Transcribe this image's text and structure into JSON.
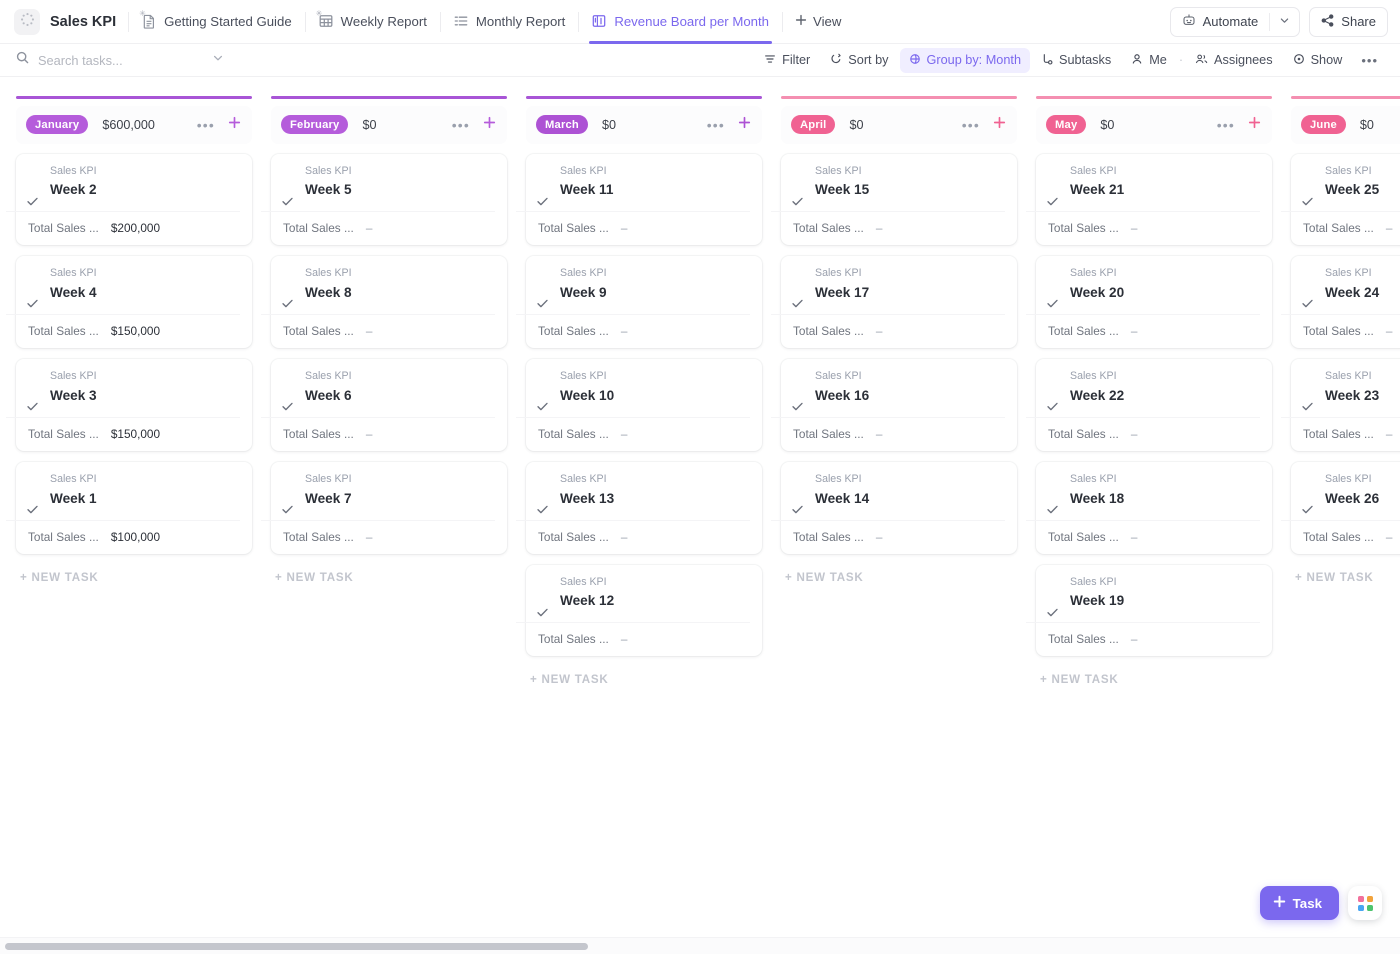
{
  "topbar": {
    "logo_icon": "dotted-circle-icon",
    "space_title": "Sales KPI",
    "tabs": [
      {
        "label": "Getting Started Guide",
        "icon": "doc-icon",
        "active": false
      },
      {
        "label": "Weekly Report",
        "icon": "table-icon",
        "active": false
      },
      {
        "label": "Monthly Report",
        "icon": "list-icon",
        "active": false
      },
      {
        "label": "Revenue Board per Month",
        "icon": "board-icon",
        "active": true
      }
    ],
    "add_view_label": "View",
    "add_view_icon": "plus-icon",
    "automate_label": "Automate",
    "automate_icon": "robot-icon",
    "automate_caret_icon": "chevron-down-icon",
    "share_label": "Share",
    "share_icon": "share-icon"
  },
  "toolbar": {
    "search_icon": "search-icon",
    "search_placeholder": "Search tasks...",
    "search_value": "",
    "search_caret_icon": "chevron-down-icon",
    "items": [
      {
        "label": "Filter",
        "icon": "filter-icon",
        "active": false
      },
      {
        "label": "Sort by",
        "icon": "sort-icon",
        "active": false
      },
      {
        "label": "Group by: Month",
        "icon": "group-icon",
        "active": true
      },
      {
        "label": "Subtasks",
        "icon": "subtask-icon",
        "active": false
      },
      {
        "label": "Me",
        "icon": "person-icon",
        "active": false
      },
      {
        "label": "Assignees",
        "icon": "people-icon",
        "active": false
      },
      {
        "label": "Show",
        "icon": "eye-icon",
        "active": false
      }
    ],
    "separator": "·",
    "more_icon": "ellipsis-icon"
  },
  "board": {
    "new_task_label": "+ NEW TASK",
    "card_list_label": "Sales KPI",
    "field_label": "Total Sales ...",
    "empty_value": "–",
    "check_icon": "check-icon",
    "more_icon": "ellipsis-icon",
    "add_icon": "plus-icon",
    "columns": [
      {
        "month": "January",
        "sum": "$600,000",
        "color": "#b55cdb",
        "top_color": "#a855d6",
        "cards": [
          {
            "title": "Week 2",
            "value": "$200,000"
          },
          {
            "title": "Week 4",
            "value": "$150,000"
          },
          {
            "title": "Week 3",
            "value": "$150,000"
          },
          {
            "title": "Week 1",
            "value": "$100,000"
          }
        ]
      },
      {
        "month": "February",
        "sum": "$0",
        "color": "#b55cdb",
        "top_color": "#a855d6",
        "cards": [
          {
            "title": "Week 5",
            "value": "–"
          },
          {
            "title": "Week 8",
            "value": "–"
          },
          {
            "title": "Week 6",
            "value": "–"
          },
          {
            "title": "Week 7",
            "value": "–"
          }
        ]
      },
      {
        "month": "March",
        "sum": "$0",
        "color": "#ad52d4",
        "top_color": "#a855d6",
        "cards": [
          {
            "title": "Week 11",
            "value": "–"
          },
          {
            "title": "Week 9",
            "value": "–"
          },
          {
            "title": "Week 10",
            "value": "–"
          },
          {
            "title": "Week 13",
            "value": "–"
          },
          {
            "title": "Week 12",
            "value": "–"
          }
        ]
      },
      {
        "month": "April",
        "sum": "$0",
        "color": "#f06292",
        "top_color": "#f48fb1",
        "cards": [
          {
            "title": "Week 15",
            "value": "–"
          },
          {
            "title": "Week 17",
            "value": "–"
          },
          {
            "title": "Week 16",
            "value": "–"
          },
          {
            "title": "Week 14",
            "value": "–"
          }
        ]
      },
      {
        "month": "May",
        "sum": "$0",
        "color": "#f06292",
        "top_color": "#f48fb1",
        "cards": [
          {
            "title": "Week 21",
            "value": "–"
          },
          {
            "title": "Week 20",
            "value": "–"
          },
          {
            "title": "Week 22",
            "value": "–"
          },
          {
            "title": "Week 18",
            "value": "–"
          },
          {
            "title": "Week 19",
            "value": "–"
          }
        ]
      },
      {
        "month": "June",
        "sum": "$0",
        "color": "#f06292",
        "top_color": "#f48fb1",
        "cards": [
          {
            "title": "Week 25",
            "value": "–"
          },
          {
            "title": "Week 24",
            "value": "–"
          },
          {
            "title": "Week 23",
            "value": "–"
          },
          {
            "title": "Week 26",
            "value": "–"
          }
        ]
      }
    ]
  },
  "floating": {
    "task_label": "Task",
    "task_icon": "plus-icon",
    "apps_icon": "apps-grid-icon",
    "apps_colors": [
      "#f2719c",
      "#f2a33c",
      "#49a6f2",
      "#4ec46e"
    ]
  }
}
